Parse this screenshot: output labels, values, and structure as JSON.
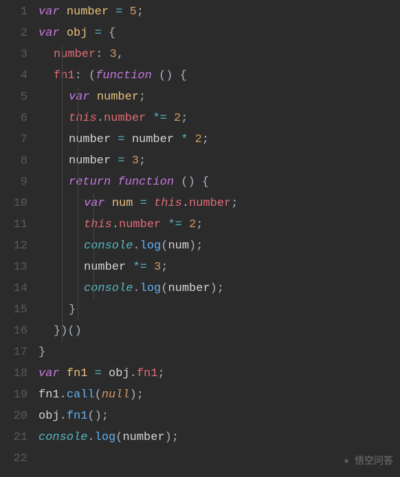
{
  "lines": [
    {
      "n": 1,
      "indent": 0,
      "tokens": [
        {
          "c": "kw",
          "t": "var"
        },
        {
          "c": "id",
          "t": " "
        },
        {
          "c": "def",
          "t": "number"
        },
        {
          "c": "id",
          "t": " "
        },
        {
          "c": "op",
          "t": "="
        },
        {
          "c": "id",
          "t": " "
        },
        {
          "c": "num",
          "t": "5"
        },
        {
          "c": "punct",
          "t": ";"
        }
      ],
      "guides": []
    },
    {
      "n": 2,
      "indent": 0,
      "tokens": [
        {
          "c": "kw",
          "t": "var"
        },
        {
          "c": "id",
          "t": " "
        },
        {
          "c": "def",
          "t": "obj"
        },
        {
          "c": "id",
          "t": " "
        },
        {
          "c": "op",
          "t": "="
        },
        {
          "c": "id",
          "t": " "
        },
        {
          "c": "punct",
          "t": "{"
        }
      ],
      "guides": []
    },
    {
      "n": 3,
      "indent": 1,
      "tokens": [
        {
          "c": "prop",
          "t": "number"
        },
        {
          "c": "punct",
          "t": ": "
        },
        {
          "c": "num",
          "t": "3"
        },
        {
          "c": "punct",
          "t": ","
        }
      ],
      "guides": [
        "ig1"
      ]
    },
    {
      "n": 4,
      "indent": 1,
      "tokens": [
        {
          "c": "prop",
          "t": "fn1"
        },
        {
          "c": "punct",
          "t": ": "
        },
        {
          "c": "paren",
          "t": "("
        },
        {
          "c": "kwfn",
          "t": "function"
        },
        {
          "c": "id",
          "t": " "
        },
        {
          "c": "paren",
          "t": "()"
        },
        {
          "c": "id",
          "t": " "
        },
        {
          "c": "punct",
          "t": "{"
        }
      ],
      "guides": [
        "ig1"
      ]
    },
    {
      "n": 5,
      "indent": 2,
      "tokens": [
        {
          "c": "kw",
          "t": "var"
        },
        {
          "c": "id",
          "t": " "
        },
        {
          "c": "def",
          "t": "number"
        },
        {
          "c": "punct",
          "t": ";"
        }
      ],
      "guides": [
        "ig1",
        "ig2"
      ]
    },
    {
      "n": 6,
      "indent": 2,
      "tokens": [
        {
          "c": "this",
          "t": "this"
        },
        {
          "c": "punct",
          "t": "."
        },
        {
          "c": "prop",
          "t": "number"
        },
        {
          "c": "id",
          "t": " "
        },
        {
          "c": "op",
          "t": "*="
        },
        {
          "c": "id",
          "t": " "
        },
        {
          "c": "num",
          "t": "2"
        },
        {
          "c": "punct",
          "t": ";"
        }
      ],
      "guides": [
        "ig1",
        "ig2"
      ]
    },
    {
      "n": 7,
      "indent": 2,
      "tokens": [
        {
          "c": "id",
          "t": "number "
        },
        {
          "c": "op",
          "t": "="
        },
        {
          "c": "id",
          "t": " number "
        },
        {
          "c": "op",
          "t": "*"
        },
        {
          "c": "id",
          "t": " "
        },
        {
          "c": "num",
          "t": "2"
        },
        {
          "c": "punct",
          "t": ";"
        }
      ],
      "guides": [
        "ig1",
        "ig2"
      ]
    },
    {
      "n": 8,
      "indent": 2,
      "tokens": [
        {
          "c": "id",
          "t": "number "
        },
        {
          "c": "op",
          "t": "="
        },
        {
          "c": "id",
          "t": " "
        },
        {
          "c": "num",
          "t": "3"
        },
        {
          "c": "punct",
          "t": ";"
        }
      ],
      "guides": [
        "ig1",
        "ig2"
      ]
    },
    {
      "n": 9,
      "indent": 2,
      "tokens": [
        {
          "c": "kw",
          "t": "return"
        },
        {
          "c": "id",
          "t": " "
        },
        {
          "c": "kwfn",
          "t": "function"
        },
        {
          "c": "id",
          "t": " "
        },
        {
          "c": "paren",
          "t": "()"
        },
        {
          "c": "id",
          "t": " "
        },
        {
          "c": "punct",
          "t": "{"
        }
      ],
      "guides": [
        "ig1",
        "ig2"
      ]
    },
    {
      "n": 10,
      "indent": 3,
      "tokens": [
        {
          "c": "kw",
          "t": "var"
        },
        {
          "c": "id",
          "t": " "
        },
        {
          "c": "def",
          "t": "num"
        },
        {
          "c": "id",
          "t": " "
        },
        {
          "c": "op",
          "t": "="
        },
        {
          "c": "id",
          "t": " "
        },
        {
          "c": "this",
          "t": "this"
        },
        {
          "c": "punct",
          "t": "."
        },
        {
          "c": "prop",
          "t": "number"
        },
        {
          "c": "punct",
          "t": ";"
        }
      ],
      "guides": [
        "ig1",
        "ig2",
        "ig3"
      ]
    },
    {
      "n": 11,
      "indent": 3,
      "tokens": [
        {
          "c": "this",
          "t": "this"
        },
        {
          "c": "punct",
          "t": "."
        },
        {
          "c": "prop",
          "t": "number"
        },
        {
          "c": "id",
          "t": " "
        },
        {
          "c": "op",
          "t": "*="
        },
        {
          "c": "id",
          "t": " "
        },
        {
          "c": "num",
          "t": "2"
        },
        {
          "c": "punct",
          "t": ";"
        }
      ],
      "guides": [
        "ig1",
        "ig2",
        "ig3"
      ]
    },
    {
      "n": 12,
      "indent": 3,
      "tokens": [
        {
          "c": "consolekw",
          "t": "console"
        },
        {
          "c": "punct",
          "t": "."
        },
        {
          "c": "methodcall",
          "t": "log"
        },
        {
          "c": "paren",
          "t": "("
        },
        {
          "c": "id",
          "t": "num"
        },
        {
          "c": "paren",
          "t": ")"
        },
        {
          "c": "punct",
          "t": ";"
        }
      ],
      "guides": [
        "ig1",
        "ig2",
        "ig3"
      ]
    },
    {
      "n": 13,
      "indent": 3,
      "tokens": [
        {
          "c": "id",
          "t": "number "
        },
        {
          "c": "op",
          "t": "*="
        },
        {
          "c": "id",
          "t": " "
        },
        {
          "c": "num",
          "t": "3"
        },
        {
          "c": "punct",
          "t": ";"
        }
      ],
      "guides": [
        "ig1",
        "ig2",
        "ig3"
      ]
    },
    {
      "n": 14,
      "indent": 3,
      "tokens": [
        {
          "c": "consolekw",
          "t": "console"
        },
        {
          "c": "punct",
          "t": "."
        },
        {
          "c": "methodcall",
          "t": "log"
        },
        {
          "c": "paren",
          "t": "("
        },
        {
          "c": "id",
          "t": "number"
        },
        {
          "c": "paren",
          "t": ")"
        },
        {
          "c": "punct",
          "t": ";"
        }
      ],
      "guides": [
        "ig1",
        "ig2",
        "ig3"
      ]
    },
    {
      "n": 15,
      "indent": 2,
      "tokens": [
        {
          "c": "punct",
          "t": "}"
        }
      ],
      "guides": [
        "ig1",
        "ig2"
      ]
    },
    {
      "n": 16,
      "indent": 1,
      "tokens": [
        {
          "c": "punct",
          "t": "}"
        },
        {
          "c": "paren",
          "t": ")()"
        }
      ],
      "guides": [
        "ig1"
      ]
    },
    {
      "n": 17,
      "indent": 0,
      "tokens": [
        {
          "c": "punct",
          "t": "}"
        }
      ],
      "guides": []
    },
    {
      "n": 18,
      "indent": 0,
      "tokens": [
        {
          "c": "kw",
          "t": "var"
        },
        {
          "c": "id",
          "t": " "
        },
        {
          "c": "def",
          "t": "fn1"
        },
        {
          "c": "id",
          "t": " "
        },
        {
          "c": "op",
          "t": "="
        },
        {
          "c": "id",
          "t": " obj"
        },
        {
          "c": "punct",
          "t": "."
        },
        {
          "c": "prop",
          "t": "fn1"
        },
        {
          "c": "punct",
          "t": ";"
        }
      ],
      "guides": []
    },
    {
      "n": 19,
      "indent": 0,
      "tokens": [
        {
          "c": "id",
          "t": "fn1"
        },
        {
          "c": "punct",
          "t": "."
        },
        {
          "c": "methodcall",
          "t": "call"
        },
        {
          "c": "paren",
          "t": "("
        },
        {
          "c": "null",
          "t": "null"
        },
        {
          "c": "paren",
          "t": ")"
        },
        {
          "c": "punct",
          "t": ";"
        }
      ],
      "guides": []
    },
    {
      "n": 20,
      "indent": 0,
      "tokens": [
        {
          "c": "id",
          "t": "obj"
        },
        {
          "c": "punct",
          "t": "."
        },
        {
          "c": "methodcall",
          "t": "fn1"
        },
        {
          "c": "paren",
          "t": "()"
        },
        {
          "c": "punct",
          "t": ";"
        }
      ],
      "guides": []
    },
    {
      "n": 21,
      "indent": 0,
      "tokens": [
        {
          "c": "consolekw",
          "t": "console"
        },
        {
          "c": "punct",
          "t": "."
        },
        {
          "c": "methodcall",
          "t": "log"
        },
        {
          "c": "paren",
          "t": "("
        },
        {
          "c": "id",
          "t": "number"
        },
        {
          "c": "paren",
          "t": ")"
        },
        {
          "c": "punct",
          "t": ";"
        }
      ],
      "guides": []
    },
    {
      "n": 22,
      "indent": 0,
      "tokens": [],
      "guides": []
    }
  ],
  "watermark": "悟空问答",
  "indentSize": 22,
  "baseIndent": 0
}
